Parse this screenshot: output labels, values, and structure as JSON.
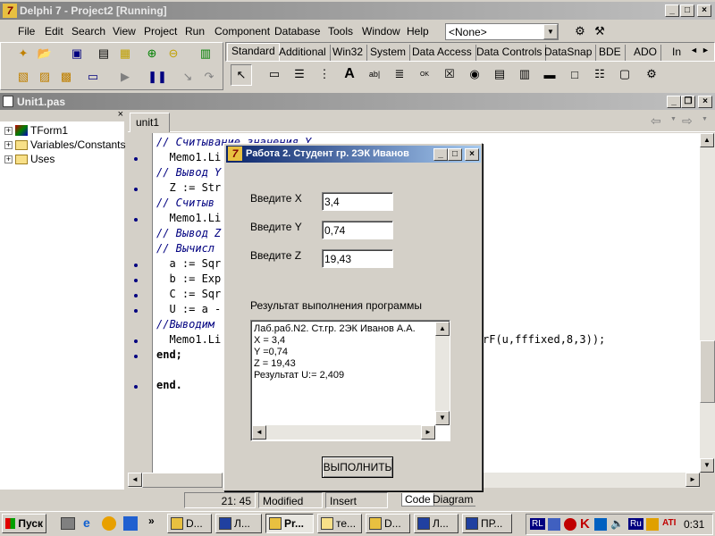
{
  "main_window": {
    "title": "Delphi 7 - Project2 [Running]"
  },
  "menu": [
    "File",
    "Edit",
    "Search",
    "View",
    "Project",
    "Run",
    "Component",
    "Database",
    "Tools",
    "Window",
    "Help"
  ],
  "component_combo": {
    "value": "<None>"
  },
  "palette_tabs": [
    "Standard",
    "Additional",
    "Win32",
    "System",
    "Data Access",
    "Data Controls",
    "DataSnap",
    "BDE",
    "ADO",
    "In"
  ],
  "editor_window": {
    "title": "Unit1.pas",
    "tab": "unit1"
  },
  "tree": [
    "TForm1",
    "Variables/Constants",
    "Uses"
  ],
  "code_lines": [
    {
      "text": "// Считывание значения Y",
      "type": "comment",
      "bullet": false
    },
    {
      "text": "  Memo1.Li",
      "type": "code",
      "bullet": true
    },
    {
      "text": "// Вывод Y",
      "type": "comment",
      "bullet": false
    },
    {
      "text": "  Z := Str",
      "type": "code",
      "bullet": true
    },
    {
      "text": "// Считыв",
      "type": "comment",
      "bullet": false
    },
    {
      "text": "  Memo1.Li",
      "type": "code",
      "bullet": true
    },
    {
      "text": "// Вывод Z",
      "type": "comment",
      "bullet": false
    },
    {
      "text": "// Вычисл",
      "type": "comment",
      "bullet": false
    },
    {
      "text": "  a := Sqr",
      "type": "code",
      "bullet": true
    },
    {
      "text": "  b := Exp",
      "type": "code",
      "bullet": true
    },
    {
      "text": "  C := Sqr",
      "type": "code",
      "bullet": true
    },
    {
      "text": "  U := a -",
      "type": "code",
      "bullet": true
    },
    {
      "text": "//Выводим",
      "type": "comment",
      "bullet": false
    },
    {
      "text": "  Memo1.Li",
      "type": "code",
      "bullet": true
    },
    {
      "text": "end;",
      "type": "kw",
      "bullet": true
    },
    {
      "text": "",
      "type": "code",
      "bullet": false
    },
    {
      "text": "end.",
      "type": "kw",
      "bullet": true
    }
  ],
  "code_tail": "rF(u,fffixed,8,3));",
  "status": {
    "position": "21:  45",
    "modified": "Modified",
    "mode": "Insert"
  },
  "bottom_tabs": [
    "Code",
    "Diagram"
  ],
  "dialog": {
    "title": "Работа 2. Студент гр. 2ЭК Иванов",
    "label_x": "Введите X",
    "value_x": "3,4",
    "label_y": "Введите Y",
    "value_y": "0,74",
    "label_z": "Введите Z",
    "value_z": "19,43",
    "result_label": "Результат выполнения программы",
    "memo_lines": [
      "Лаб.раб.N2. Ст.гр. 2ЭК Иванов А.А.",
      "X = 3,4",
      "Y =0,74",
      "Z = 19,43",
      "Результат U:= 2,409"
    ],
    "run_button": "ВЫПОЛНИТЬ"
  },
  "taskbar": {
    "start": "Пуск",
    "tasks": [
      "D...",
      "Л...",
      "Pr...",
      "те...",
      "D...",
      "Л...",
      "ПР..."
    ],
    "clock": "0:31",
    "lang": "Ru",
    "tray_rl": "RL"
  }
}
